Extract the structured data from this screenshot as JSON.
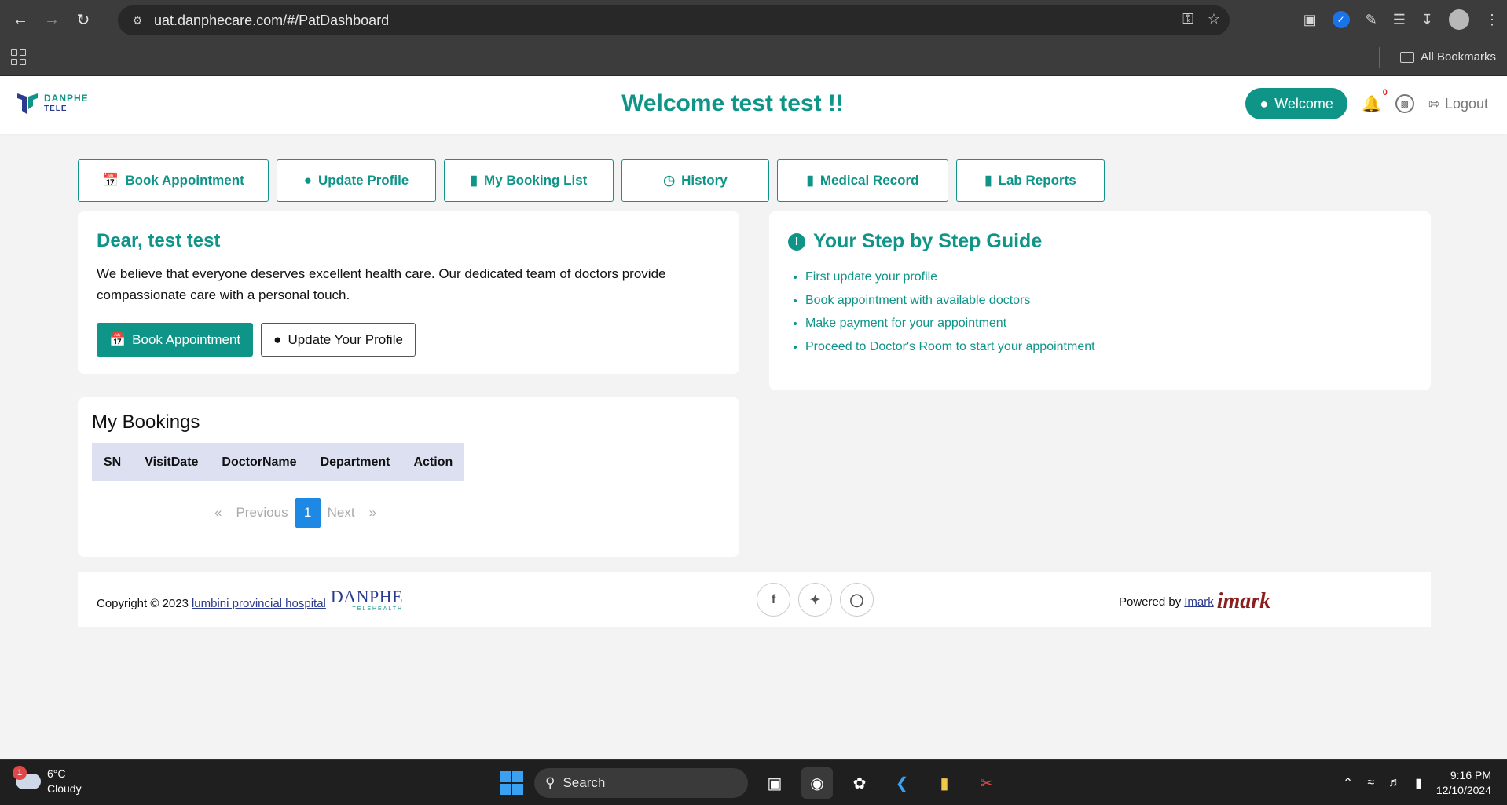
{
  "browser": {
    "url": "uat.danphecare.com/#/PatDashboard",
    "bookmarks_label": "All Bookmarks"
  },
  "header": {
    "logo_line1": "DANPHE",
    "logo_line2": "TELE",
    "title": "Welcome test test !!",
    "welcome_button": "Welcome",
    "notification_count": "0",
    "logout": "Logout"
  },
  "tabs": [
    {
      "label": "Book Appointment",
      "icon": "calendar-icon"
    },
    {
      "label": "Update Profile",
      "icon": "user-icon"
    },
    {
      "label": "My Booking List",
      "icon": "book-icon"
    },
    {
      "label": "History",
      "icon": "clock-icon"
    },
    {
      "label": "Medical Record",
      "icon": "book-icon"
    },
    {
      "label": "Lab Reports",
      "icon": "book-icon"
    }
  ],
  "intro": {
    "greeting": "Dear, test test",
    "message": "We believe that everyone deserves excellent health care. Our dedicated team of doctors provide compassionate care with a personal touch.",
    "book_button": "Book Appointment",
    "profile_button": "Update Your Profile"
  },
  "guide": {
    "title": "Your Step by Step Guide",
    "steps": [
      "First update your profile",
      "Book appointment with available doctors",
      "Make payment for your appointment",
      "Proceed to Doctor's Room to start your appointment"
    ]
  },
  "bookings": {
    "title": "My Bookings",
    "columns": [
      "SN",
      "VisitDate",
      "DoctorName",
      "Department",
      "Action"
    ],
    "pager": {
      "first": "«",
      "previous": "Previous",
      "current": "1",
      "next": "Next",
      "last": "»"
    }
  },
  "footer": {
    "copyright_prefix": "Copyright © 2023",
    "hospital_link": "lumbini provincial hospital",
    "danphe_logo": "DANPHE",
    "danphe_sub": "TELEHEALTH",
    "powered_by": "Powered by",
    "imark_link": "Imark",
    "imark_logo": "imark"
  },
  "taskbar": {
    "weather_temp": "6°C",
    "weather_desc": "Cloudy",
    "weather_badge": "1",
    "search": "Search",
    "time": "9:16 PM",
    "date": "12/10/2024"
  },
  "colors": {
    "brand": "#0f9488",
    "navy": "#2b3c8f",
    "pager_active": "#1e88e5"
  }
}
